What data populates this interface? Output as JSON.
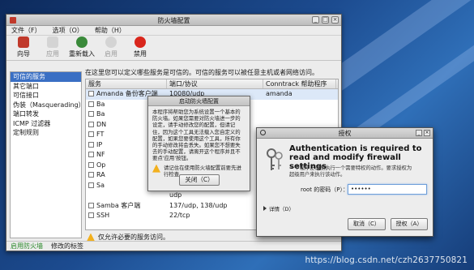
{
  "main_window": {
    "title": "防火墙配置",
    "controls": {
      "minimize": "_",
      "maximize": "□",
      "close": "×"
    }
  },
  "menu": [
    "文件（F）",
    "选项（O）",
    "帮助（H）"
  ],
  "toolbar": [
    {
      "label": "向导",
      "icon": "wizard-icon",
      "enabled": true,
      "color": "#c0392b"
    },
    {
      "label": "应用",
      "icon": "check-icon",
      "enabled": false
    },
    {
      "label": "重新载入",
      "icon": "reload-icon",
      "enabled": true,
      "color": "#3a8a3a"
    },
    {
      "label": "启用",
      "icon": "enable-icon",
      "enabled": false
    },
    {
      "label": "禁用",
      "icon": "disable-icon",
      "enabled": true,
      "color": "#d9261c"
    }
  ],
  "sidebar": [
    "可信的服务",
    "其它端口",
    "可信接口",
    "伪装（Masquerading）",
    "端口转发",
    "ICMP 过滤器",
    "定制规则"
  ],
  "sidebar_selected": 0,
  "content": {
    "description": "在这里您可以定义哪些服务是可信的。可信的服务可以被任意主机或者网络访问。",
    "columns": [
      "服务",
      "端口/协议",
      "Conntrack 帮助程序"
    ],
    "rows": [
      {
        "service": "Amanda 备份客户端",
        "port": "10080/udp",
        "helper": "amanda"
      },
      {
        "service": "Ba",
        "port": "",
        "helper": ""
      },
      {
        "service": "Ba",
        "port": "",
        "helper": ""
      },
      {
        "service": "DN",
        "port": "",
        "helper": ""
      },
      {
        "service": "FT",
        "port": "",
        "helper": ""
      },
      {
        "service": "IP",
        "port": "",
        "helper": ""
      },
      {
        "service": "NF",
        "port": "",
        "helper": ""
      },
      {
        "service": "Op",
        "port": "",
        "helper": ""
      },
      {
        "service": "RA",
        "port": "",
        "helper": ""
      },
      {
        "service": "Sa",
        "port": "",
        "helper": ""
      },
      {
        "service": "",
        "port": "udp",
        "helper": ""
      },
      {
        "service": "Samba 客户端",
        "port": "137/udp, 138/udp",
        "helper": ""
      },
      {
        "service": "SSH",
        "port": "22/tcp",
        "helper": ""
      }
    ],
    "warning": "仅允许必要的服务访问。"
  },
  "statusbar": {
    "state": "启用防火墙",
    "modified": "修改的标签"
  },
  "startup_dialog": {
    "title": "启动防火墙配置",
    "body": "本程序将帮助您为系统设置一个基本的防火墙。如果您需要对防火墙进一步的设定，请手动修改您的配置，但请记住，因为这个工具无法载入您自定义的配置，如果您要使用这个工具，所有你的手动修改将会丢失。如果您不想要失去的手动配置，请离开这个程序并且不要点'应用'按钮。",
    "hint": "请记住在使用防火墙配置前要先进行检查。",
    "close_label": "关闭（C）"
  },
  "auth_dialog": {
    "title": "授权",
    "heading_line1": "Authentication is required to",
    "heading_line2": "read and modify firewall settings",
    "sub_line1": "一个程序正试图执行一个需要特权的动作。要求授权为",
    "sub_line2": "超级用户来执行该动作。",
    "password_label": "root 的密码（P）：",
    "password_value": "••••••",
    "details_label": "详情（D）",
    "cancel_label": "取消（C）",
    "ok_label": "授权（A）"
  },
  "watermark": "https://blog.csdn.net/czh2637750821"
}
